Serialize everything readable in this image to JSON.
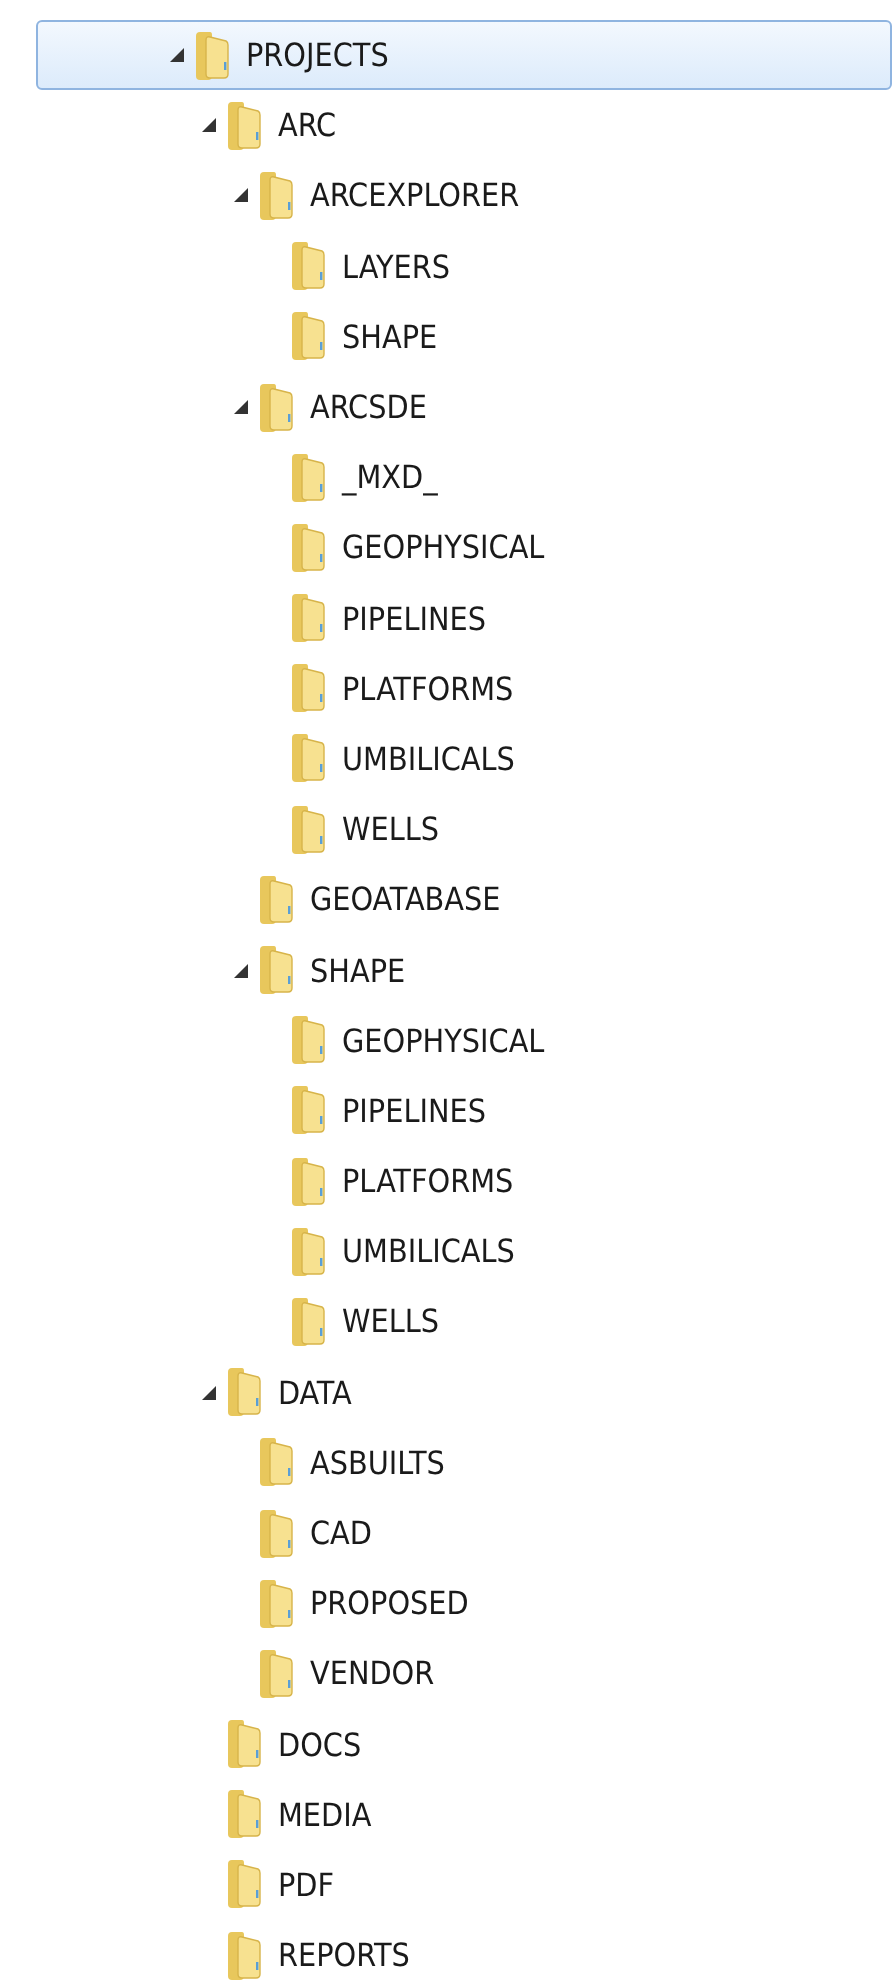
{
  "tree": [
    {
      "name": "PROJECTS",
      "selected": true,
      "expanded": true,
      "children": [
        {
          "name": "ARC",
          "selected": false,
          "expanded": true,
          "children": [
            {
              "name": "ARCEXPLORER",
              "selected": false,
              "expanded": true,
              "children": [
                {
                  "name": "LAYERS",
                  "selected": false
                },
                {
                  "name": "SHAPE",
                  "selected": false
                }
              ]
            },
            {
              "name": "ARCSDE",
              "selected": false,
              "expanded": true,
              "children": [
                {
                  "name": "_MXD_",
                  "selected": false
                },
                {
                  "name": "GEOPHYSICAL",
                  "selected": false
                },
                {
                  "name": "PIPELINES",
                  "selected": false
                },
                {
                  "name": "PLATFORMS",
                  "selected": false
                },
                {
                  "name": "UMBILICALS",
                  "selected": false
                },
                {
                  "name": "WELLS",
                  "selected": false
                }
              ]
            },
            {
              "name": "GEOATABASE",
              "selected": false
            },
            {
              "name": "SHAPE",
              "selected": false,
              "expanded": true,
              "children": [
                {
                  "name": "GEOPHYSICAL",
                  "selected": false
                },
                {
                  "name": "PIPELINES",
                  "selected": false
                },
                {
                  "name": "PLATFORMS",
                  "selected": false
                },
                {
                  "name": "UMBILICALS",
                  "selected": false
                },
                {
                  "name": "WELLS",
                  "selected": false
                }
              ]
            }
          ]
        },
        {
          "name": "DATA",
          "selected": false,
          "expanded": true,
          "children": [
            {
              "name": "ASBUILTS",
              "selected": false
            },
            {
              "name": "CAD",
              "selected": false
            },
            {
              "name": "PROPOSED",
              "selected": false
            },
            {
              "name": "VENDOR",
              "selected": false
            }
          ]
        },
        {
          "name": "DOCS",
          "selected": false
        },
        {
          "name": "MEDIA",
          "selected": false
        },
        {
          "name": "PDF",
          "selected": false
        },
        {
          "name": "REPORTS",
          "selected": false
        }
      ]
    }
  ]
}
